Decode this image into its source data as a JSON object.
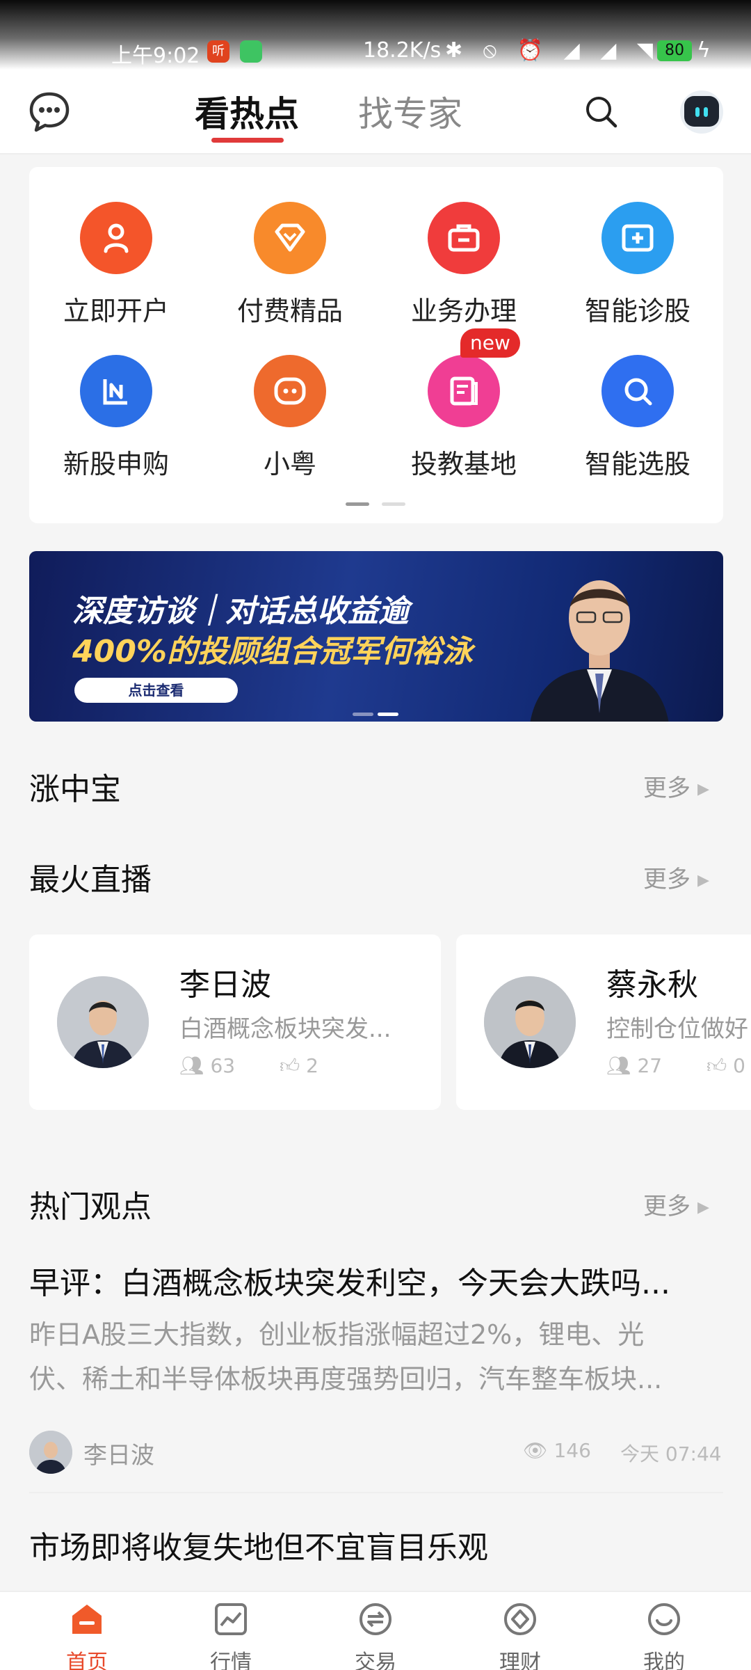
{
  "status_bar": {
    "time": "上午9:02",
    "app_badge": "听",
    "speed": "18.2K/s",
    "battery": "80"
  },
  "top_nav": {
    "tabs": [
      {
        "label": "看热点",
        "active": true
      },
      {
        "label": "找专家",
        "active": false
      }
    ]
  },
  "quick_entries": [
    {
      "label": "立即开户",
      "icon": "user-icon",
      "color": "#f4552a"
    },
    {
      "label": "付费精品",
      "icon": "diamond-icon",
      "color": "#f88a2b"
    },
    {
      "label": "业务办理",
      "icon": "briefcase-icon",
      "color": "#f03c3c"
    },
    {
      "label": "智能诊股",
      "icon": "medical-kit-icon",
      "color": "#2b9ef0"
    },
    {
      "label": "新股申购",
      "icon": "ipo-icon",
      "color": "#2b6fe6"
    },
    {
      "label": "小粤",
      "icon": "robot-face-icon",
      "color": "#ee6a2d"
    },
    {
      "label": "投教基地",
      "icon": "book-icon",
      "color": "#f03e94"
    },
    {
      "label": "智能选股",
      "icon": "magnifier-icon",
      "color": "#2f6ff0"
    }
  ],
  "new_badge": "new",
  "banner": {
    "line1": "深度访谈｜对话总收益逾",
    "line2": "400%的投顾组合冠军何裕泳",
    "cta": "点击查看"
  },
  "sections": {
    "zhangzhongbao": {
      "title": "涨中宝",
      "more": "更多"
    },
    "live": {
      "title": "最火直播",
      "more": "更多"
    },
    "views": {
      "title": "热门观点",
      "more": "更多"
    }
  },
  "live_cards": [
    {
      "name": "李日波",
      "desc": "白酒概念板块突发...",
      "viewers": "63",
      "likes": "2"
    },
    {
      "name": "蔡永秋",
      "desc": "控制仓位做好",
      "viewers": "27",
      "likes": "0"
    }
  ],
  "articles": [
    {
      "title": "早评：白酒概念板块突发利空，今天会大跌吗...",
      "summary_line1": "昨日A股三大指数，创业板指涨幅超过2%，锂电、光",
      "summary_line2": "伏、稀土和半导体板块再度强势回归，汽车整车板块...",
      "author": "李日波",
      "views": "146",
      "time": "今天 07:44"
    },
    {
      "title": "市场即将收复失地但不宜盲目乐观"
    }
  ],
  "bottom_nav": [
    {
      "label": "首页",
      "active": true
    },
    {
      "label": "行情",
      "active": false
    },
    {
      "label": "交易",
      "active": false
    },
    {
      "label": "理财",
      "active": false
    },
    {
      "label": "我的",
      "active": false
    }
  ]
}
